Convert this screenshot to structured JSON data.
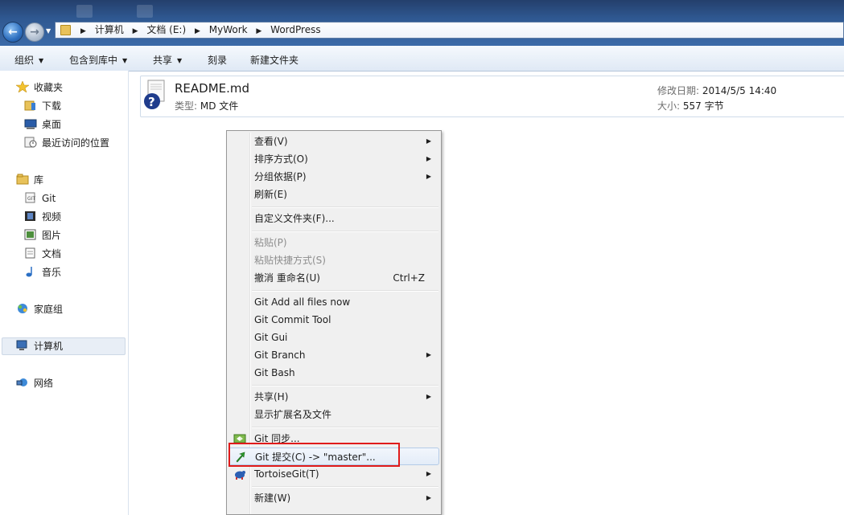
{
  "address": {
    "crumbs": [
      "计算机",
      "文档 (E:)",
      "MyWork",
      "WordPress"
    ]
  },
  "toolbar": {
    "organize": "组织",
    "include_library": "包含到库中",
    "share": "共享",
    "burn": "刻录",
    "new_folder": "新建文件夹"
  },
  "nav": {
    "favorites": "收藏夹",
    "downloads": "下载",
    "desktop": "桌面",
    "recent": "最近访问的位置",
    "libraries": "库",
    "git": "Git",
    "videos": "视频",
    "pictures": "图片",
    "documents": "文档",
    "music": "音乐",
    "homegroup": "家庭组",
    "computer": "计算机",
    "network": "网络"
  },
  "file": {
    "name": "README.md",
    "type_label": "类型:",
    "type_value": "MD 文件",
    "date_label": "修改日期:",
    "date_value": "2014/5/5 14:40",
    "size_label": "大小:",
    "size_value": "557 字节"
  },
  "menu": {
    "view": "查看(V)",
    "sort_by": "排序方式(O)",
    "group_by": "分组依据(P)",
    "refresh": "刷新(E)",
    "customize": "自定义文件夹(F)...",
    "paste": "粘贴(P)",
    "paste_shortcut": "粘贴快捷方式(S)",
    "undo_rename": "撤消 重命名(U)",
    "undo_shortcut": "Ctrl+Z",
    "git_add_all": "Git Add all files now",
    "git_commit_tool": "Git Commit Tool",
    "git_gui": "Git Gui",
    "git_branch": "Git Branch",
    "git_bash": "Git Bash",
    "share": "共享(H)",
    "show_ext": "显示扩展名及文件",
    "git_sync": "Git 同步...",
    "git_commit": "Git 提交(C) -> \"master\"...",
    "tortoisegit": "TortoiseGit(T)",
    "new": "新建(W)"
  },
  "colors": {
    "titlebar": "#2f5891",
    "highlight_box": "#e01b1b",
    "menu_bg": "#f0f0f0"
  }
}
